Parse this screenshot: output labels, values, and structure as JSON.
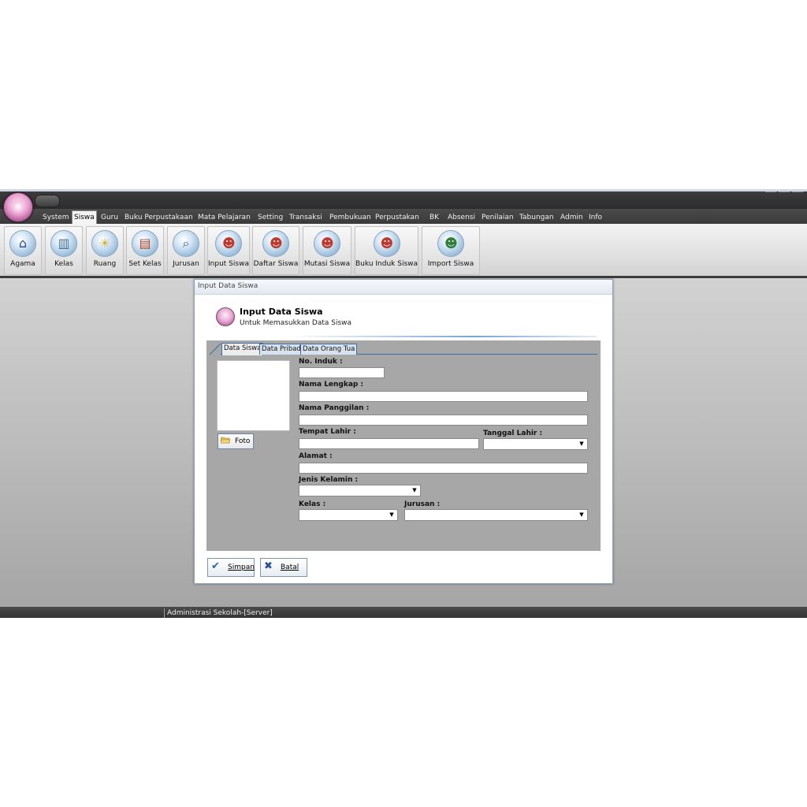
{
  "menu": {
    "items": [
      "System",
      "Siswa",
      "Guru",
      "Buku Perpustakaan",
      "Mata Pelajaran",
      "Setting",
      "Transaksi",
      "Pembukuan",
      "Perpustakan",
      "BK",
      "Absensi",
      "Penilaian",
      "Tabungan",
      "Admin",
      "Info"
    ],
    "active": "Siswa"
  },
  "ribbon": {
    "buttons": [
      {
        "label": "Agama",
        "icon": "house-icon"
      },
      {
        "label": "Kelas",
        "icon": "building-icon"
      },
      {
        "label": "Ruang",
        "icon": "room-icon"
      },
      {
        "label": "Set Kelas",
        "icon": "books-icon"
      },
      {
        "label": "Jurusan",
        "icon": "monitor-search-icon"
      },
      {
        "label": "Input Siswa",
        "icon": "students-icon"
      },
      {
        "label": "Daftar Siswa",
        "icon": "students-list-icon"
      },
      {
        "label": "Mutasi Siswa",
        "icon": "student-move-icon"
      },
      {
        "label": "Buku Induk Siswa",
        "icon": "students-book-icon"
      },
      {
        "label": "Import Siswa",
        "icon": "students-import-icon"
      }
    ]
  },
  "status": {
    "text": "Administrasi Sekolah-[Server]"
  },
  "dialog": {
    "window_title": "Input Data Siswa",
    "header_title": "Input Data Siswa",
    "header_subtitle": "Untuk Memasukkan Data Siswa",
    "tabs": [
      "Data Siswa",
      "Data Pribadi",
      "Data Orang Tua"
    ],
    "active_tab": "Data Siswa",
    "foto_button": "Foto",
    "fields": {
      "no_induk": {
        "label": "No. Induk :",
        "value": ""
      },
      "nama_lengkap": {
        "label": "Nama Lengkap :",
        "value": ""
      },
      "nama_panggilan": {
        "label": "Nama Panggilan :",
        "value": ""
      },
      "tempat_lahir": {
        "label": "Tempat Lahir :",
        "value": ""
      },
      "tanggal_lahir": {
        "label": "Tanggal Lahir :",
        "value": ""
      },
      "alamat": {
        "label": "Alamat :",
        "value": ""
      },
      "jenis_kelamin": {
        "label": "Jenis Kelamin :",
        "value": ""
      },
      "kelas": {
        "label": "Kelas :",
        "value": ""
      },
      "jurusan": {
        "label": "Jurusan :",
        "value": ""
      }
    },
    "buttons": {
      "simpan": "Simpan",
      "batal": "Batal"
    }
  },
  "colors": {
    "accent": "#3f6da8",
    "panel": "#a7a7a7",
    "chrome_dark": "#3a3a3a"
  }
}
